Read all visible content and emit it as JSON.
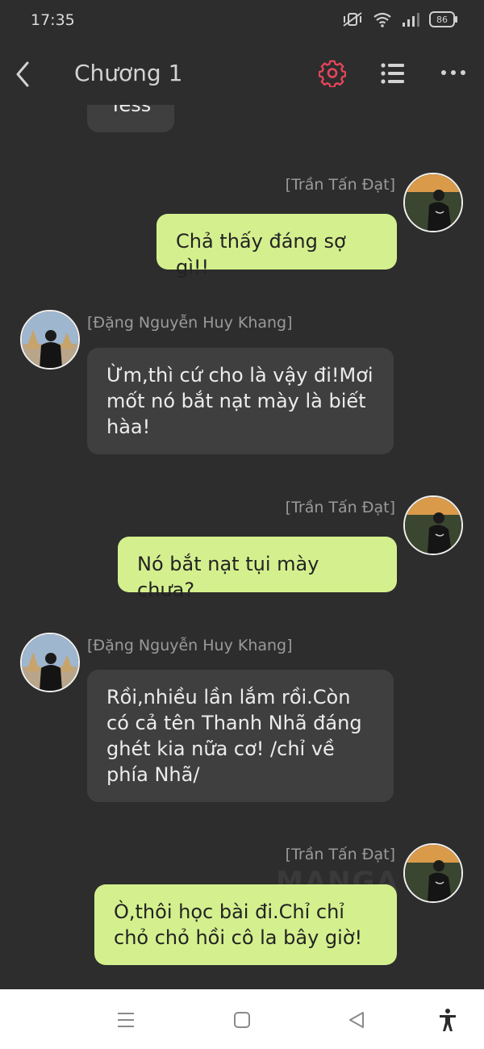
{
  "status": {
    "time": "17:35",
    "battery": "86"
  },
  "header": {
    "title": "Chương 1"
  },
  "messages": [
    {
      "side": "other",
      "text": "Yess"
    },
    {
      "side": "me",
      "name": "[Trần Tấn Đạt]",
      "text": "Chả thấy đáng sợ gì!!"
    },
    {
      "side": "other",
      "name": "[Đặng Nguyễn Huy Khang]",
      "text": "Ừm,thì cứ cho là vậy đi!Mơi mốt nó bắt nạt mày là biết hàa!"
    },
    {
      "side": "me",
      "name": "[Trần Tấn Đạt]",
      "text": "Nó bắt nạt tụi mày chưa?"
    },
    {
      "side": "other",
      "name": "[Đặng Nguyễn Huy Khang]",
      "text": "Rồi,nhiều lần lắm rồi.Còn có cả tên Thanh Nhã đáng ghét kia nữa cơ! /chỉ về phía Nhã/"
    },
    {
      "side": "me",
      "name": "[Trần Tấn Đạt]",
      "text": "Ò,thôi học bài đi.Chỉ chỉ chỏ chỏ hồi cô la bây giờ!"
    }
  ],
  "watermark": "MANGA",
  "colors": {
    "accent": "#e8455a",
    "my_bubble": "#d4f08e",
    "other_bubble": "#3f3f3f",
    "background": "#2d2d2d"
  },
  "icons": [
    "back-icon",
    "gear-icon",
    "list-icon",
    "more-icon",
    "menu-icon",
    "home-icon",
    "back-triangle-icon",
    "accessibility-icon"
  ]
}
